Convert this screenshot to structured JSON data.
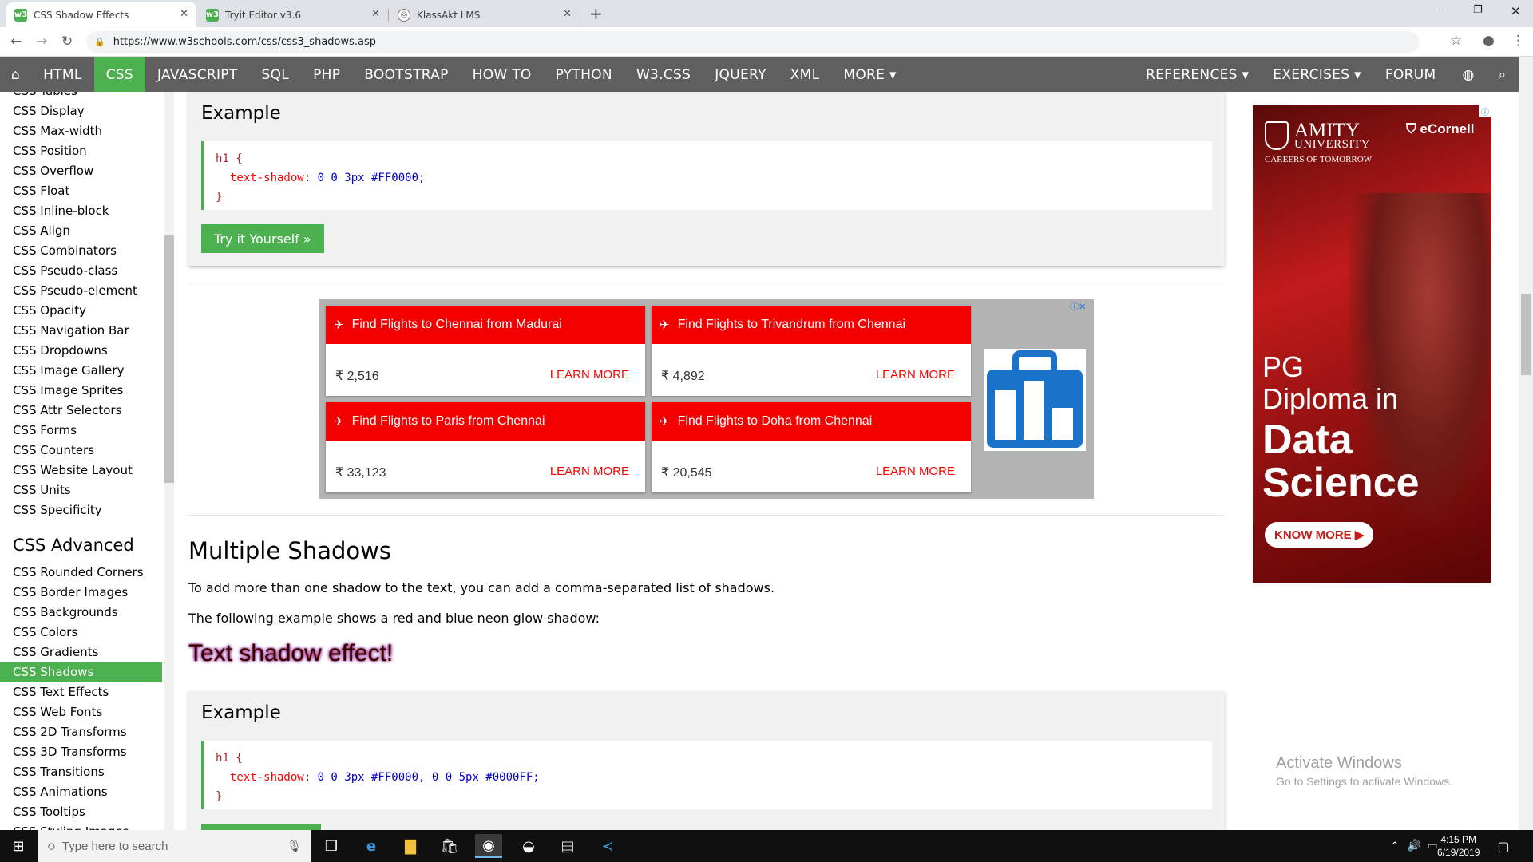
{
  "browser": {
    "tabs": [
      {
        "title": "CSS Shadow Effects",
        "favicon": "w3"
      },
      {
        "title": "Tryit Editor v3.6",
        "favicon": "w3"
      },
      {
        "title": "KlassAkt LMS",
        "favicon": "globe"
      }
    ],
    "url": "https://www.w3schools.com/css/css3_shadows.asp"
  },
  "topnav": {
    "items": [
      "HTML",
      "CSS",
      "JAVASCRIPT",
      "SQL",
      "PHP",
      "BOOTSTRAP",
      "HOW TO",
      "PYTHON",
      "W3.CSS",
      "JQUERY",
      "XML",
      "MORE ▾"
    ],
    "right": [
      "REFERENCES ▾",
      "EXERCISES ▾",
      "FORUM"
    ],
    "active": "CSS"
  },
  "sidebar": {
    "top_items": [
      "CSS Tables",
      "CSS Display",
      "CSS Max-width",
      "CSS Position",
      "CSS Overflow",
      "CSS Float",
      "CSS Inline-block",
      "CSS Align",
      "CSS Combinators",
      "CSS Pseudo-class",
      "CSS Pseudo-element",
      "CSS Opacity",
      "CSS Navigation Bar",
      "CSS Dropdowns",
      "CSS Image Gallery",
      "CSS Image Sprites",
      "CSS Attr Selectors",
      "CSS Forms",
      "CSS Counters",
      "CSS Website Layout",
      "CSS Units",
      "CSS Specificity"
    ],
    "heading": "CSS Advanced",
    "advanced_items": [
      "CSS Rounded Corners",
      "CSS Border Images",
      "CSS Backgrounds",
      "CSS Colors",
      "CSS Gradients",
      "CSS Shadows",
      "CSS Text Effects",
      "CSS Web Fonts",
      "CSS 2D Transforms",
      "CSS 3D Transforms",
      "CSS Transitions",
      "CSS Animations",
      "CSS Tooltips",
      "CSS Styling Images"
    ],
    "active": "CSS Shadows"
  },
  "example1": {
    "title": "Example",
    "code": {
      "selector": "h1 {",
      "prop": "text-shadow",
      "value": "0 0 3px #FF0000;",
      "close": "}"
    },
    "button": "Try it Yourself »"
  },
  "flight_ad": {
    "cards": [
      {
        "title": "Find Flights to Chennai from Madurai",
        "price": "₹ 2,516",
        "cta": "LEARN MORE"
      },
      {
        "title": "Find Flights to Trivandrum from Chennai",
        "price": "₹ 4,892",
        "cta": "LEARN MORE"
      },
      {
        "title": "Find Flights to Paris from Chennai",
        "price": "₹ 33,123",
        "cta": "LEARN MORE"
      },
      {
        "title": "Find Flights to Doha from Chennai",
        "price": "₹ 20,545",
        "cta": "LEARN MORE"
      }
    ]
  },
  "section": {
    "title": "Multiple Shadows",
    "para1": "To add more than one shadow to the text, you can add a comma-separated list of shadows.",
    "para2": "The following example shows a red and blue neon glow shadow:",
    "demo": "Text shadow effect!"
  },
  "example2": {
    "title": "Example",
    "code": {
      "selector": "h1 {",
      "prop": "text-shadow",
      "value": "0 0 3px #FF0000, 0 0 5px #0000FF;",
      "close": "}"
    }
  },
  "side_ad": {
    "brand": "AMITY",
    "brand_sub": "UNIVERSITY",
    "tagline": "CAREERS OF TOMORROW",
    "partner": "eCornell",
    "headline1": "PG",
    "headline2": "Diploma in",
    "headline3": "Data",
    "headline4": "Science",
    "cta": "KNOW MORE"
  },
  "watermark": {
    "line1": "Activate Windows",
    "line2": "Go to Settings to activate Windows."
  },
  "taskbar": {
    "search_placeholder": "Type here to search",
    "time": "4:15 PM",
    "date": "6/19/2019"
  }
}
